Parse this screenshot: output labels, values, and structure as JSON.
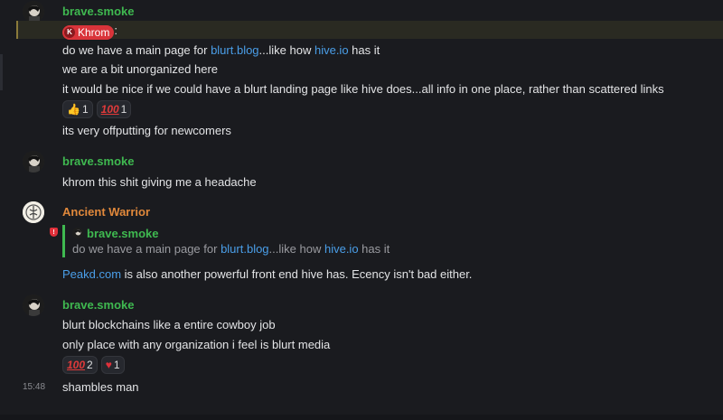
{
  "messages": [
    {
      "author": "brave.smoke",
      "mention_name": "Khrom",
      "mention_suffix": ":",
      "line1_pre": "do we have a main page for ",
      "line1_link1": "blurt.blog",
      "line1_mid": "...like how ",
      "line1_link2": "hive.io",
      "line1_post": " has it",
      "line2": "we are a bit unorganized here",
      "line3": "it would be nice if we could have a blurt landing page like hive does...all info in one place, rather than scattered links",
      "reactions": [
        {
          "icon": "👍",
          "count": "1"
        },
        {
          "icon": "100",
          "count": "1"
        }
      ],
      "line4": "its very offputting for newcomers"
    },
    {
      "author": "brave.smoke",
      "line1": "khrom this shit giving me a headache"
    },
    {
      "author": "Ancient Warrior",
      "quote_author": "brave.smoke",
      "quote_pre": "do we have a main page for ",
      "quote_link1": "blurt.blog",
      "quote_mid": "...like how ",
      "quote_link2": "hive.io",
      "quote_post": " has it",
      "line1_link": "Peakd.com",
      "line1_post": " is also another powerful front end hive has. Ecency isn't bad either."
    },
    {
      "author": "brave.smoke",
      "line1": "blurt blockchains like a entire cowboy job",
      "line2": "only place with any organization i feel is blurt media",
      "reactions": [
        {
          "icon": "100",
          "count": "2"
        },
        {
          "icon": "♥",
          "count": "1"
        }
      ],
      "timestamp": "15:48",
      "line3": "shambles man"
    }
  ],
  "colors": {
    "background": "#1a1b1f",
    "author_green": "#3fb950",
    "author_orange": "#e0883b",
    "link": "#4a9ee8",
    "mention": "#d9343a"
  }
}
